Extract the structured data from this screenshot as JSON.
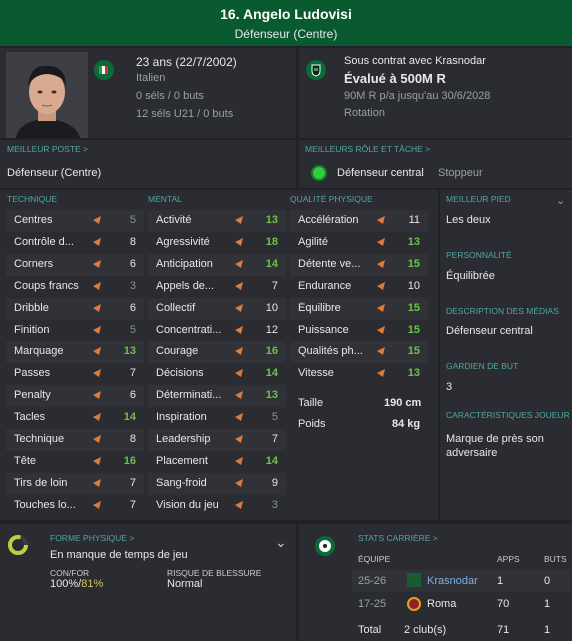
{
  "header": {
    "title": "16. Angelo Ludovisi",
    "position": "Défenseur (Centre)"
  },
  "bio": {
    "age": "23 ans (22/7/2002)",
    "nationality": "Italien",
    "caps": "0 séls / 0 buts",
    "u21": "12 séls U21 / 0 buts"
  },
  "contract": {
    "club_line": "Sous contrat avec Krasnodar",
    "value": "Évalué à 500M R",
    "wage": "90M R p/a jusqu'au 30/6/2028",
    "role": "Rotation"
  },
  "best_position": {
    "header": "MEILLEUR POSTE >",
    "value": "Défenseur (Centre)"
  },
  "best_role": {
    "header": "MEILLEURS RÔLE ET TÂCHE >",
    "role": "Défenseur central",
    "duty": "Stoppeur"
  },
  "attr_headers": {
    "technique": "TECHNIQUE",
    "mental": "MENTAL",
    "physical": "QUALITÉ PHYSIQUE"
  },
  "technique": [
    {
      "n": "Centres",
      "v": "5"
    },
    {
      "n": "Contrôle d...",
      "v": "8"
    },
    {
      "n": "Corners",
      "v": "6"
    },
    {
      "n": "Coups francs",
      "v": "3"
    },
    {
      "n": "Dribble",
      "v": "6"
    },
    {
      "n": "Finition",
      "v": "5"
    },
    {
      "n": "Marquage",
      "v": "13"
    },
    {
      "n": "Passes",
      "v": "7"
    },
    {
      "n": "Penalty",
      "v": "6"
    },
    {
      "n": "Tacles",
      "v": "14"
    },
    {
      "n": "Technique",
      "v": "8"
    },
    {
      "n": "Tête",
      "v": "16"
    },
    {
      "n": "Tirs de loin",
      "v": "7"
    },
    {
      "n": "Touches lo...",
      "v": "7"
    }
  ],
  "mental": [
    {
      "n": "Activité",
      "v": "13"
    },
    {
      "n": "Agressivité",
      "v": "18"
    },
    {
      "n": "Anticipation",
      "v": "14"
    },
    {
      "n": "Appels de...",
      "v": "7"
    },
    {
      "n": "Collectif",
      "v": "10"
    },
    {
      "n": "Concentrati...",
      "v": "12"
    },
    {
      "n": "Courage",
      "v": "16"
    },
    {
      "n": "Décisions",
      "v": "14"
    },
    {
      "n": "Déterminati...",
      "v": "13"
    },
    {
      "n": "Inspiration",
      "v": "5"
    },
    {
      "n": "Leadership",
      "v": "7"
    },
    {
      "n": "Placement",
      "v": "14"
    },
    {
      "n": "Sang-froid",
      "v": "9"
    },
    {
      "n": "Vision du jeu",
      "v": "3"
    }
  ],
  "physical": [
    {
      "n": "Accélération",
      "v": "11"
    },
    {
      "n": "Agilité",
      "v": "13"
    },
    {
      "n": "Détente ve...",
      "v": "15"
    },
    {
      "n": "Endurance",
      "v": "10"
    },
    {
      "n": "Équilibre",
      "v": "15"
    },
    {
      "n": "Puissance",
      "v": "15"
    },
    {
      "n": "Qualités ph...",
      "v": "15"
    },
    {
      "n": "Vitesse",
      "v": "13"
    }
  ],
  "size": {
    "height_label": "Taille",
    "height": "190 cm",
    "weight_label": "Poids",
    "weight": "84 kg"
  },
  "side": {
    "foot_h": "MEILLEUR PIED",
    "foot": "Les deux",
    "pers_h": "PERSONNALITÉ",
    "pers": "Équilibrée",
    "media_h": "DESCRIPTION DES MÉDIAS",
    "media": "Défenseur central",
    "gk_h": "GARDIEN DE BUT",
    "gk": "3",
    "traits_h": "CARACTÉRISTIQUES JOUEUR",
    "traits": "Marque de près son adversaire"
  },
  "fitness": {
    "header": "FORME PHYSIQUE >",
    "status": "En manque de temps de jeu",
    "confor_h": "CON/FOR",
    "con": "100%",
    "for": "81%",
    "risk_h": "RISQUE DE BLESSURE",
    "risk": "Normal"
  },
  "career": {
    "header": "STATS CARRIÈRE >",
    "cols": [
      "ÉQUIPE",
      "APPS",
      "BUTS"
    ],
    "rows": [
      {
        "season": "25-26",
        "team": "Krasnodar",
        "apps": "1",
        "goals": "0"
      },
      {
        "season": "17-25",
        "team": "Roma",
        "apps": "70",
        "goals": "1"
      }
    ],
    "total": {
      "label": "Total",
      "clubs": "2 club(s)",
      "apps": "71",
      "goals": "1"
    }
  },
  "colors": {
    "header": "#0a5a31",
    "accent": "#4fa8a0",
    "green": "#6cc24a",
    "arrow": "#e07a3a"
  }
}
